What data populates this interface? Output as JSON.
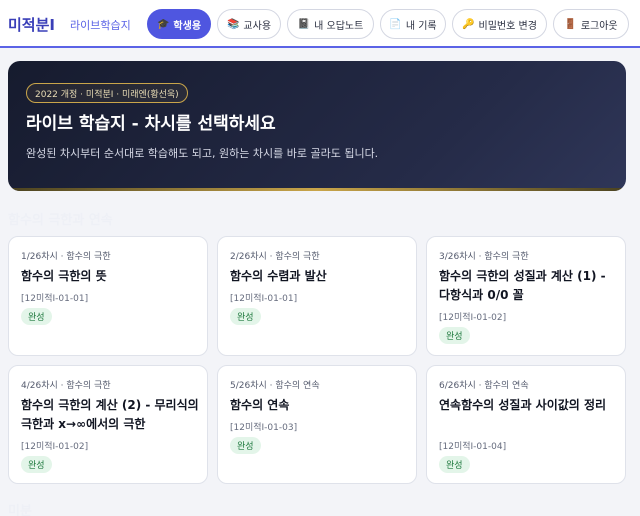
{
  "header": {
    "title": "미적분Ⅰ",
    "subtitle": "라이브학습지",
    "nav": [
      {
        "icon": "graduation-cap-icon",
        "glyph": "🎓",
        "label": "학생용",
        "active": true
      },
      {
        "icon": "books-icon",
        "glyph": "📚",
        "label": "교사용",
        "active": false
      },
      {
        "icon": "notebook-icon",
        "glyph": "📓",
        "label": "내 오답노트",
        "active": false
      },
      {
        "icon": "document-icon",
        "glyph": "📄",
        "label": "내 기록",
        "active": false
      },
      {
        "icon": "key-icon",
        "glyph": "🔑",
        "label": "비밀번호 변경",
        "active": false
      },
      {
        "icon": "door-icon",
        "glyph": "🚪",
        "label": "로그아웃",
        "active": false
      }
    ]
  },
  "hero": {
    "badge": "2022 개정 · 미적분Ⅰ · 미래엔(황선욱)",
    "title": "라이브 학습지 - 차시를 선택하세요",
    "description": "완성된 차시부터 순서대로 학습해도 되고, 원하는 차시를 바로 골라도 됩니다."
  },
  "sections": [
    {
      "title": "함수의 극한과 연속",
      "lessons": [
        {
          "meta": "1/26차시 · 함수의 극한",
          "title": "함수의 극한의 뜻",
          "code": "[12미적Ⅰ-01-01]",
          "status": "완성"
        },
        {
          "meta": "2/26차시 · 함수의 극한",
          "title": "함수의 수렴과 발산",
          "code": "[12미적Ⅰ-01-01]",
          "status": "완성"
        },
        {
          "meta": "3/26차시 · 함수의 극한",
          "title": "함수의 극한의 성질과 계산 (1) - 다항식과 0/0 꼴",
          "code": "[12미적Ⅰ-01-02]",
          "status": "완성"
        },
        {
          "meta": "4/26차시 · 함수의 극한",
          "title": "함수의 극한의 계산 (2) - 무리식의 극한과 x→∞에서의 극한",
          "code": "[12미적Ⅰ-01-02]",
          "status": "완성"
        },
        {
          "meta": "5/26차시 · 함수의 연속",
          "title": "함수의 연속",
          "code": "[12미적Ⅰ-01-03]",
          "status": "완성"
        },
        {
          "meta": "6/26차시 · 함수의 연속",
          "title": "연속함수의 성질과 사이값의 정리",
          "code": "[12미적Ⅰ-01-04]",
          "status": "완성"
        }
      ]
    },
    {
      "title": "미분"
    }
  ]
}
